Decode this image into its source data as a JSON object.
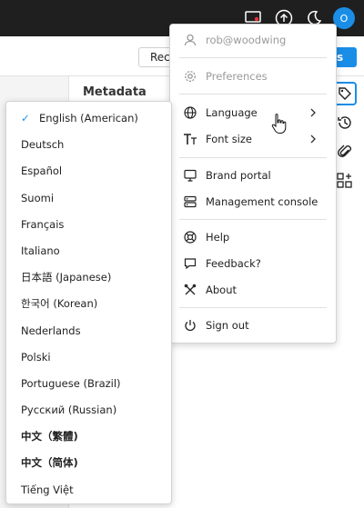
{
  "header": {
    "avatar_initial": "O"
  },
  "page": {
    "rec_button": "Rec",
    "primary_button": "s",
    "metadata_title": "Metadata"
  },
  "user_menu": {
    "email": "rob@woodwing",
    "preferences": "Preferences",
    "language": "Language",
    "font_size": "Font size",
    "brand_portal": "Brand portal",
    "management_console": "Management console",
    "help": "Help",
    "feedback": "Feedback?",
    "about": "About",
    "sign_out": "Sign out"
  },
  "languages": [
    {
      "label": "English (American)",
      "selected": true
    },
    {
      "label": "Deutsch",
      "selected": false
    },
    {
      "label": "Español",
      "selected": false
    },
    {
      "label": "Suomi",
      "selected": false
    },
    {
      "label": "Français",
      "selected": false
    },
    {
      "label": "Italiano",
      "selected": false
    },
    {
      "label": "日本語 (Japanese)",
      "selected": false
    },
    {
      "label": "한국어 (Korean)",
      "selected": false
    },
    {
      "label": "Nederlands",
      "selected": false
    },
    {
      "label": "Polski",
      "selected": false
    },
    {
      "label": "Portuguese (Brazil)",
      "selected": false
    },
    {
      "label": "Русский (Russian)",
      "selected": false
    },
    {
      "label": "中文（繁體)",
      "selected": false
    },
    {
      "label": "中文（简体)",
      "selected": false
    },
    {
      "label": "Tiếng Việt",
      "selected": false
    }
  ],
  "colors": {
    "accent": "#1a8ee6",
    "topbar": "#1f1f1f"
  }
}
